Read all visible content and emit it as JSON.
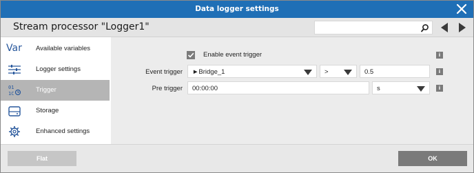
{
  "window": {
    "title": "Data logger settings"
  },
  "header": {
    "title": "Stream processor \"Logger1\"",
    "search_value": ""
  },
  "sidebar": {
    "items": [
      {
        "label": "Available variables",
        "icon": "var-icon",
        "active": false
      },
      {
        "label": "Logger settings",
        "icon": "sliders-icon",
        "active": false
      },
      {
        "label": "Trigger",
        "icon": "binary-trigger-icon",
        "active": true
      },
      {
        "label": "Storage",
        "icon": "drive-icon",
        "active": false
      },
      {
        "label": "Enhanced settings",
        "icon": "gear-icon",
        "active": false
      }
    ],
    "var_icon_text": "Var"
  },
  "main": {
    "enable_event_trigger": {
      "label": "Enable event trigger",
      "checked": true
    },
    "event_trigger": {
      "label": "Event trigger",
      "source": "►Bridge_1",
      "operator": ">",
      "value": "0.5"
    },
    "pre_trigger": {
      "label": "Pre trigger",
      "value": "00:00:00",
      "unit": "s"
    },
    "info_label": "i"
  },
  "footer": {
    "flat_label": "Flat",
    "ok_label": "OK"
  },
  "colors": {
    "titlebar": "#1f6fb6",
    "accent_icon": "#27579c",
    "active_nav": "#b5b5b5"
  }
}
